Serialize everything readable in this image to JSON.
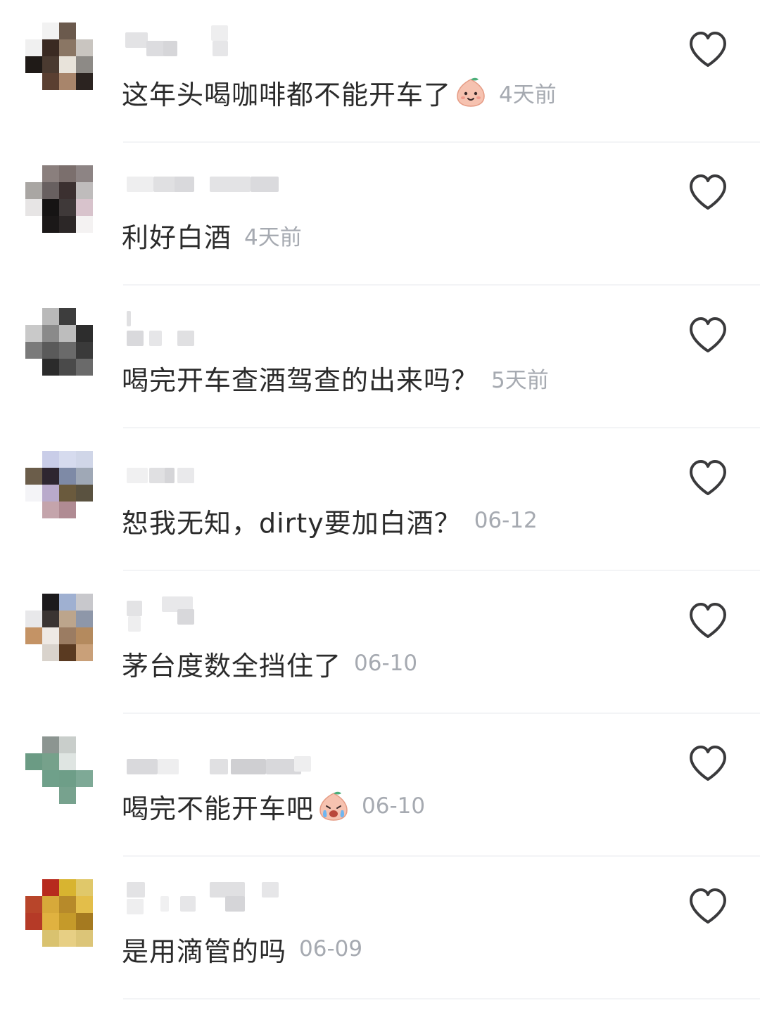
{
  "comments": [
    {
      "text": "这年头喝咖啡都不能开车了",
      "emoji": "smiling-peach-face-emoji",
      "time": "4天前",
      "avatar_colors": [
        "#ffffff",
        "#f2f2f2",
        "#6b5a4d",
        "#ffffff",
        "#f0f0f0",
        "#3a2a22",
        "#8a7664",
        "#c9c5c0",
        "#1f1a17",
        "#4a3a30",
        "#e8e3da",
        "#8d8a86",
        "#ffffff",
        "#5a3f31",
        "#a8856b",
        "#2b2320"
      ]
    },
    {
      "text": "利好白酒",
      "emoji": null,
      "time": "4天前",
      "avatar_colors": [
        "#ffffff",
        "#8a7f7d",
        "#7b6f6d",
        "#8d8484",
        "#a9a6a3",
        "#686060",
        "#3b3030",
        "#bfbcbc",
        "#e7e5e5",
        "#161414",
        "#3f3939",
        "#d8c3cc",
        "#ffffff",
        "#1b1818",
        "#2c2727",
        "#f4f2f2"
      ]
    },
    {
      "text": "喝完开车查酒驾查的出来吗？",
      "emoji": null,
      "time": "5天前",
      "avatar_colors": [
        "#ffffff",
        "#b9b9b9",
        "#3d3d3d",
        "#ffffff",
        "#c9c9c9",
        "#8a8a8a",
        "#bdbdbd",
        "#2d2d2d",
        "#7a7a7a",
        "#5a5a5a",
        "#6a6a6a",
        "#3a3a3a",
        "#ffffff",
        "#2b2b2b",
        "#4a4a4a",
        "#6a6a6a"
      ]
    },
    {
      "text": "恕我无知，dirty要加白酒？",
      "emoji": null,
      "time": "06-12",
      "avatar_colors": [
        "#ffffff",
        "#c9cde8",
        "#d6dbee",
        "#d0d6e8",
        "#6b5d4a",
        "#2e2630",
        "#7e8aa6",
        "#9fa8b6",
        "#f4f4f7",
        "#b9aacb",
        "#6a5a3d",
        "#5a5240",
        "#ffffff",
        "#c4a4ab",
        "#b08b93",
        "#ffffff"
      ]
    },
    {
      "text": "茅台度数全挡住了",
      "emoji": null,
      "time": "06-10",
      "avatar_colors": [
        "#ffffff",
        "#1c1a1c",
        "#9fb0d1",
        "#c8c8cc",
        "#e8e8ea",
        "#3a3432",
        "#bca58c",
        "#8e97a9",
        "#c49365",
        "#eee9e4",
        "#9b7c62",
        "#b48a5e",
        "#ffffff",
        "#d9d3cc",
        "#5a3a21",
        "#c9a079"
      ]
    },
    {
      "text": "喝完不能开车吧",
      "emoji": "crying-peach-face-emoji",
      "time": "06-10",
      "avatar_colors": [
        "#ffffff",
        "#8c9591",
        "#c9cecb",
        "#ffffff",
        "#6b9b84",
        "#76a18b",
        "#dfe5e2",
        "#ffffff",
        "#ffffff",
        "#6fa08a",
        "#6e9e88",
        "#7ea996",
        "#ffffff",
        "#ffffff",
        "#77a28e",
        "#ffffff"
      ]
    },
    {
      "text": "是用滴管的吗",
      "emoji": null,
      "time": "06-09",
      "avatar_colors": [
        "#ffffff",
        "#b72a1e",
        "#d8b430",
        "#e0c86a",
        "#b8452a",
        "#d7a93a",
        "#b78a2a",
        "#e3be4a",
        "#b53a27",
        "#e0b240",
        "#c59a2a",
        "#a57a20",
        "#ffffff",
        "#d9c26f",
        "#e7cf84",
        "#dcc578"
      ]
    }
  ]
}
